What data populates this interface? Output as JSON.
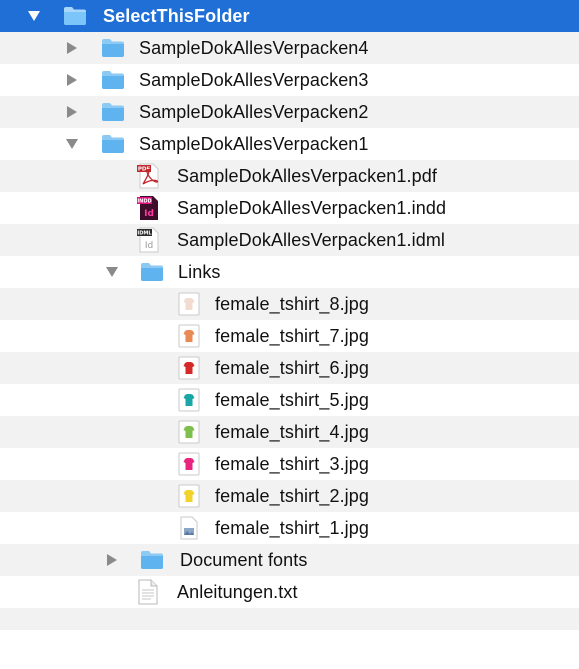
{
  "tree": {
    "root": {
      "label": "SelectThisFolder",
      "expanded": true,
      "selected": true
    },
    "folders": [
      {
        "label": "SampleDokAllesVerpacken4",
        "expanded": false
      },
      {
        "label": "SampleDokAllesVerpacken3",
        "expanded": false
      },
      {
        "label": "SampleDokAllesVerpacken2",
        "expanded": false
      },
      {
        "label": "SampleDokAllesVerpacken1",
        "expanded": true
      }
    ],
    "files": [
      {
        "label": "SampleDokAllesVerpacken1.pdf",
        "icon": "pdf-file-icon",
        "badge": "PDF"
      },
      {
        "label": "SampleDokAllesVerpacken1.indd",
        "icon": "indesign-file-icon",
        "badge": "INDD"
      },
      {
        "label": "SampleDokAllesVerpacken1.idml",
        "icon": "idml-file-icon",
        "badge": "IDML"
      }
    ],
    "links_folder": {
      "label": "Links",
      "expanded": true
    },
    "images": [
      {
        "label": "female_tshirt_8.jpg",
        "color": "#f2dcd0"
      },
      {
        "label": "female_tshirt_7.jpg",
        "color": "#e98a55"
      },
      {
        "label": "female_tshirt_6.jpg",
        "color": "#d42a2a"
      },
      {
        "label": "female_tshirt_5.jpg",
        "color": "#1aa6a6"
      },
      {
        "label": "female_tshirt_4.jpg",
        "color": "#7fbf4d"
      },
      {
        "label": "female_tshirt_3.jpg",
        "color": "#e8247e"
      },
      {
        "label": "female_tshirt_2.jpg",
        "color": "#f2d22c"
      },
      {
        "label": "female_tshirt_1.jpg",
        "color": "#8aa7c8"
      }
    ],
    "document_fonts": {
      "label": "Document fonts",
      "expanded": false
    },
    "text_file": {
      "label": "Anleitungen.txt"
    }
  },
  "colors": {
    "selection": "#1f6fd6",
    "folder": "#5fb4f0",
    "stripe": "#f2f2f2"
  }
}
